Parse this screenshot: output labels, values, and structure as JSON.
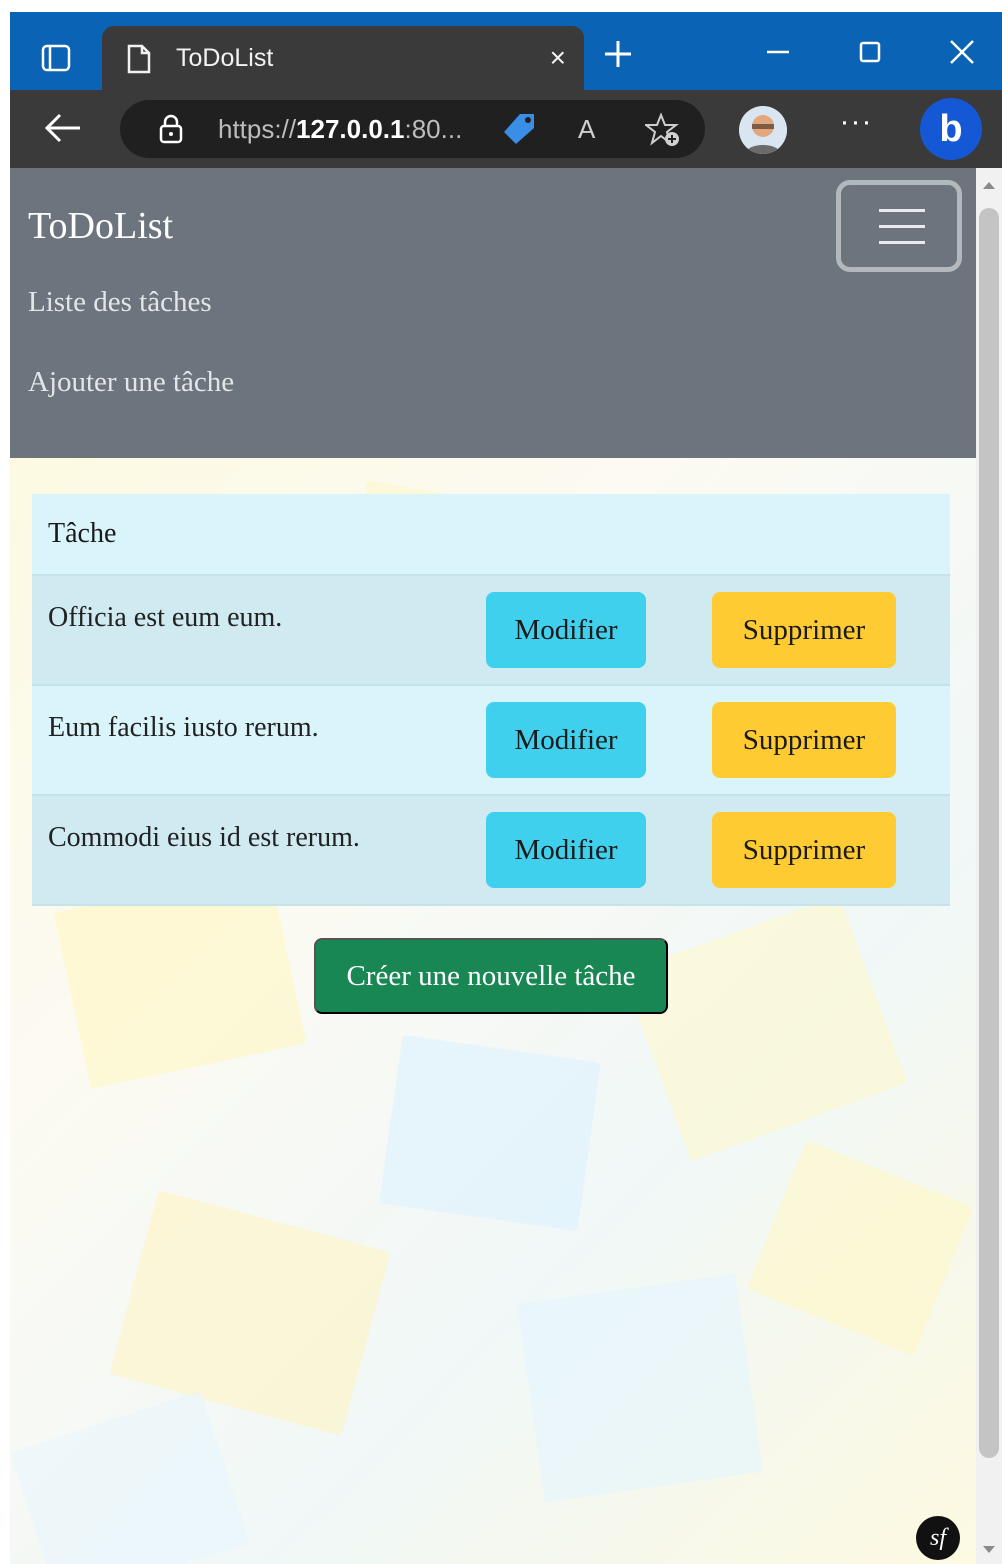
{
  "browser": {
    "tab_title": "ToDoList",
    "tab_close": "×",
    "url_prefix": "https://",
    "url_host": "127.0.0.1",
    "url_suffix": ":80...",
    "read_aloud": "A",
    "more": "···",
    "bing": "b"
  },
  "nav": {
    "brand": "ToDoList",
    "links": [
      "Liste des tâches",
      "Ajouter une tâche"
    ]
  },
  "table": {
    "header": "Tâche",
    "rows": [
      {
        "title": "Officia est eum eum.",
        "edit": "Modifier",
        "delete": "Supprimer"
      },
      {
        "title": "Eum facilis iusto rerum.",
        "edit": "Modifier",
        "delete": "Supprimer"
      },
      {
        "title": "Commodi eius id est rerum.",
        "edit": "Modifier",
        "delete": "Supprimer"
      }
    ]
  },
  "create_button": "Créer une nouvelle tâche",
  "footer_badge": "sf",
  "colors": {
    "navbar": "#6c757d",
    "edit_button": "#3fd0ee",
    "delete_button": "#ffcb32",
    "create_button": "#198754",
    "titlebar": "#0b63b6"
  }
}
